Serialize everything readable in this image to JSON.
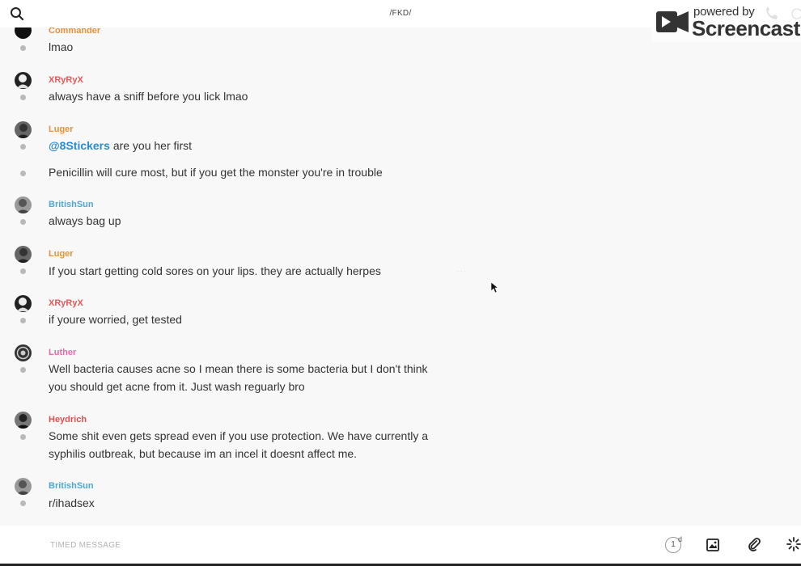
{
  "header": {
    "channel_title": "/FKD/",
    "watermark_powered": "powered by",
    "watermark_brand": "Screencastify"
  },
  "messages": [
    {
      "author": "Commander",
      "author_color": "#e5913d",
      "lines": [
        "lmao"
      ]
    },
    {
      "author": "XRyRyX",
      "author_color": "#e05a5a",
      "lines": [
        "always have a sniff before you lick lmao"
      ]
    },
    {
      "author": "Luger",
      "author_color": "#e5913d",
      "mention": "@8Stickers",
      "lines": [
        "are you her first"
      ]
    },
    {
      "author": "",
      "lines": [
        "Penicillin will cure most, but if you get the monster you're in trouble"
      ]
    },
    {
      "author": "BritishSun",
      "author_color": "#4fa7d6",
      "lines": [
        "always bag up"
      ]
    },
    {
      "author": "Luger",
      "author_color": "#e5913d",
      "lines": [
        "If you start getting cold sores on your lips. they are actually herpes"
      ]
    },
    {
      "author": "XRyRyX",
      "author_color": "#e05a5a",
      "lines": [
        "if youre worried, get tested"
      ]
    },
    {
      "author": "Luther",
      "author_color": "#e06aa8",
      "lines": [
        "Well bacteria causes acne so I mean there is some bacteria but I don't think",
        "you should get acne from it. Just wash reguarly bro"
      ]
    },
    {
      "author": "Heydrich",
      "author_color": "#d9534f",
      "lines": [
        "Some shit even gets spread even if you use protection. We have currently a",
        "syphilis outbreak, but because im an incel it doesnt affect me."
      ]
    },
    {
      "author": "BritishSun",
      "author_color": "#4fa7d6",
      "lines": [
        "r/ihadsex"
      ]
    }
  ],
  "composer": {
    "placeholder": "TIMED MESSAGE",
    "timer_value": "1",
    "timer_unit": "d"
  },
  "icons": [
    "search-icon",
    "logo-icon",
    "phone-icon",
    "info-icon",
    "image-icon",
    "paperclip-icon",
    "sparkle-icon",
    "cursor-icon"
  ]
}
